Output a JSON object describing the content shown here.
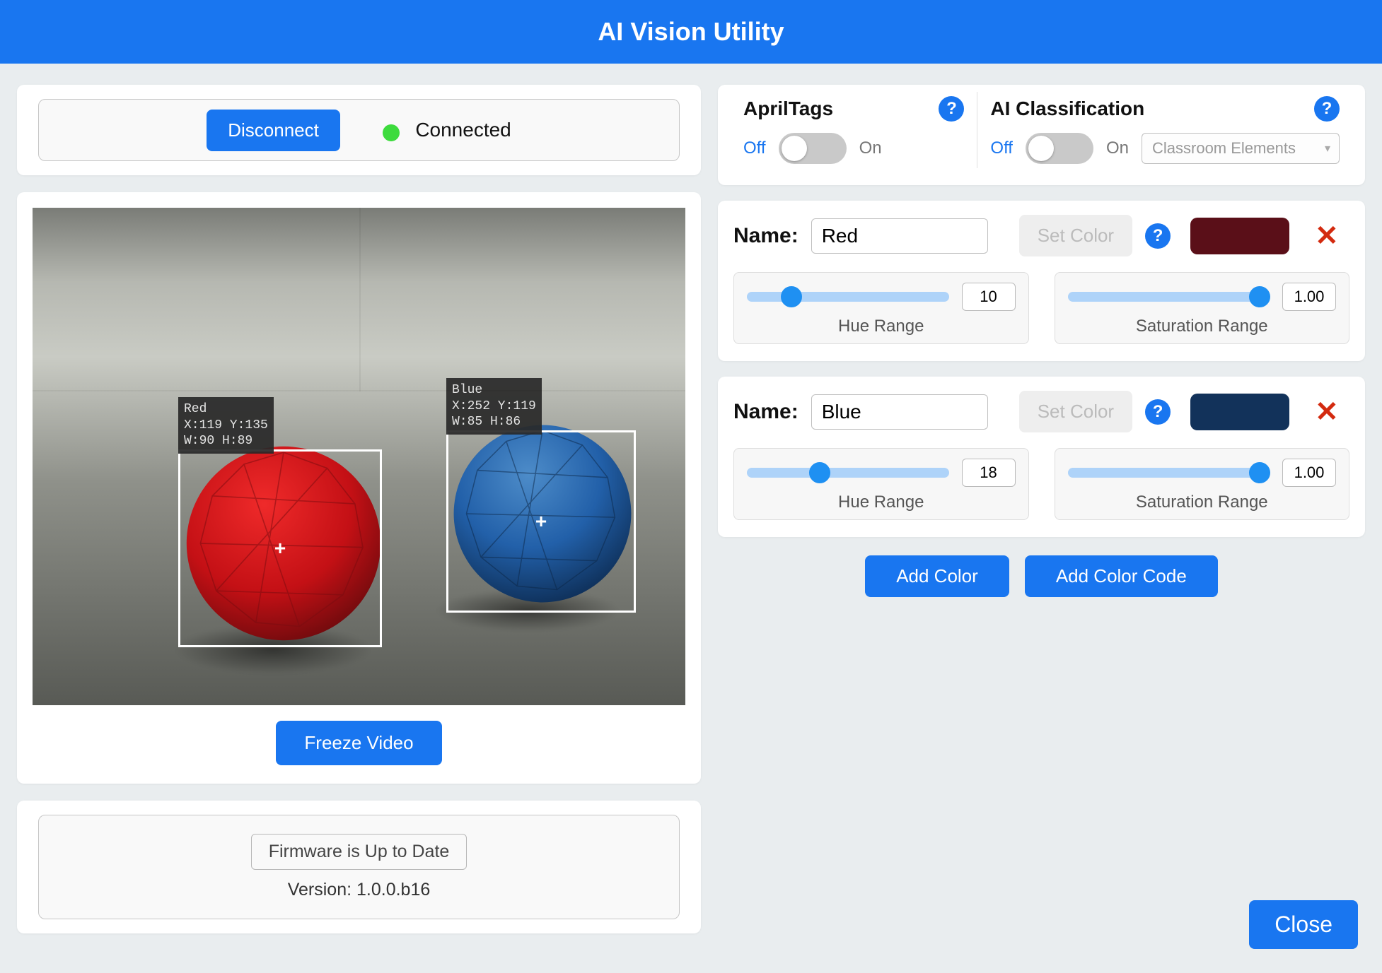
{
  "title": "AI Vision Utility",
  "connection": {
    "disconnect_label": "Disconnect",
    "status_label": "Connected"
  },
  "video": {
    "freeze_label": "Freeze Video",
    "detections": [
      {
        "name": "Red",
        "label_text": "Red\nX:119 Y:135\nW:90 H:89"
      },
      {
        "name": "Blue",
        "label_text": "Blue\nX:252 Y:119\nW:85 H:86"
      }
    ]
  },
  "firmware": {
    "button_label": "Firmware is Up to Date",
    "version_label": "Version: 1.0.0.b16"
  },
  "toggles": {
    "apriltags": {
      "title": "AprilTags",
      "off": "Off",
      "on": "On"
    },
    "ai": {
      "title": "AI Classification",
      "off": "Off",
      "on": "On",
      "model": "Classroom Elements"
    }
  },
  "colors": [
    {
      "name_label": "Name:",
      "name": "Red",
      "set_color_label": "Set Color",
      "swatch": "#5a0f18",
      "hue_value": "10",
      "hue_caption": "Hue Range",
      "sat_value": "1.00",
      "sat_caption": "Saturation Range"
    },
    {
      "name_label": "Name:",
      "name": "Blue",
      "set_color_label": "Set Color",
      "swatch": "#12325a",
      "hue_value": "18",
      "hue_caption": "Hue Range",
      "sat_value": "1.00",
      "sat_caption": "Saturation Range"
    }
  ],
  "buttons": {
    "add_color": "Add Color",
    "add_color_code": "Add Color Code",
    "close": "Close"
  }
}
